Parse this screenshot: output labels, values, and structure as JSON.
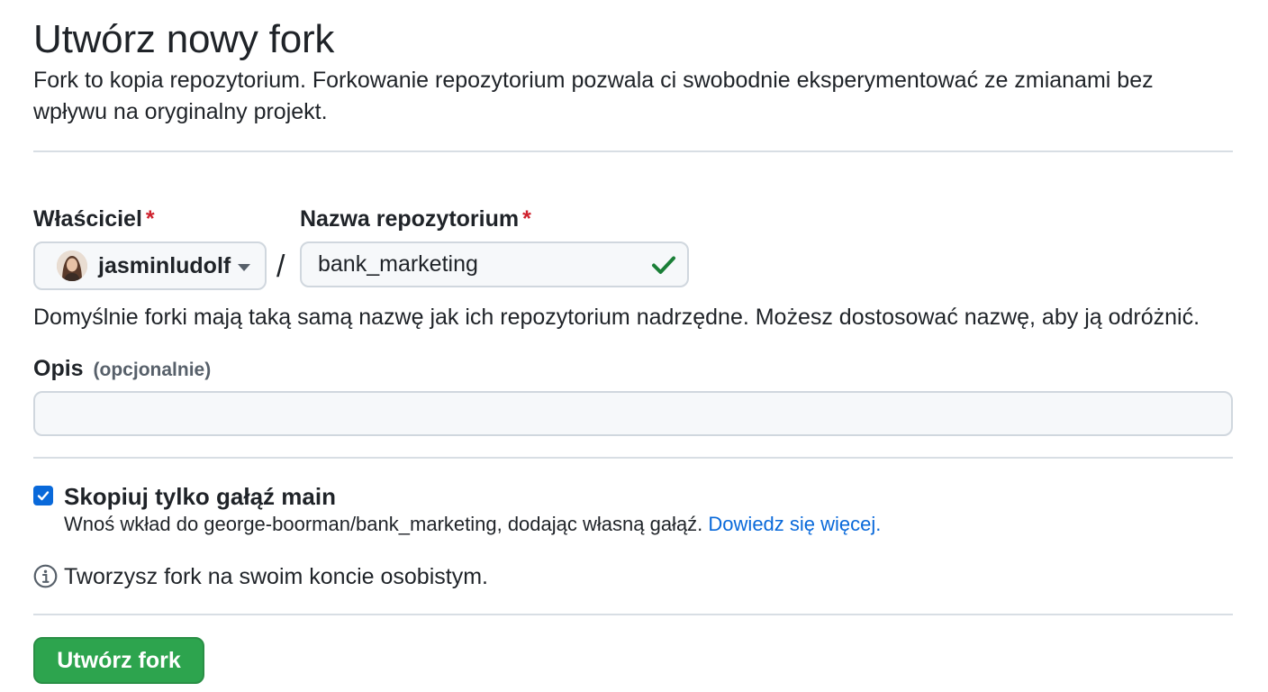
{
  "header": {
    "title": "Utwórz nowy fork",
    "subtitle": "Fork to kopia repozytorium. Forkowanie repozytorium pozwala ci swobodnie eksperymentować ze zmianami bez wpływu na oryginalny projekt."
  },
  "owner": {
    "label": "Właściciel",
    "required_mark": "*",
    "value": "jasminludolf",
    "icon": "chevron-down-icon"
  },
  "separator": "/",
  "repo_name": {
    "label": "Nazwa repozytorium",
    "required_mark": "*",
    "value": "bank_marketing",
    "valid": true,
    "icon": "check-icon"
  },
  "name_hint": "Domyślnie forki mają taką samą nazwę jak ich repozytorium nadrzędne. Możesz dostosować nazwę, aby ją odróżnić.",
  "description": {
    "label": "Opis",
    "optional": "(opcjonalnie)",
    "value": ""
  },
  "copy_main": {
    "checked": true,
    "label": "Skopiuj tylko gałąź main",
    "hint_prefix": "Wnoś wkład do george-boorman/bank_marketing, dodając własną gałąź.",
    "link_text": "Dowiedz się więcej",
    "link_suffix": "."
  },
  "info": {
    "icon": "info-icon",
    "text": "Tworzysz fork na swoim koncie osobistym."
  },
  "submit_label": "Utwórz fork",
  "colors": {
    "accent": "#0969da",
    "primary_button": "#2da44e",
    "required": "#cf222e",
    "valid_check": "#1a7f37"
  }
}
